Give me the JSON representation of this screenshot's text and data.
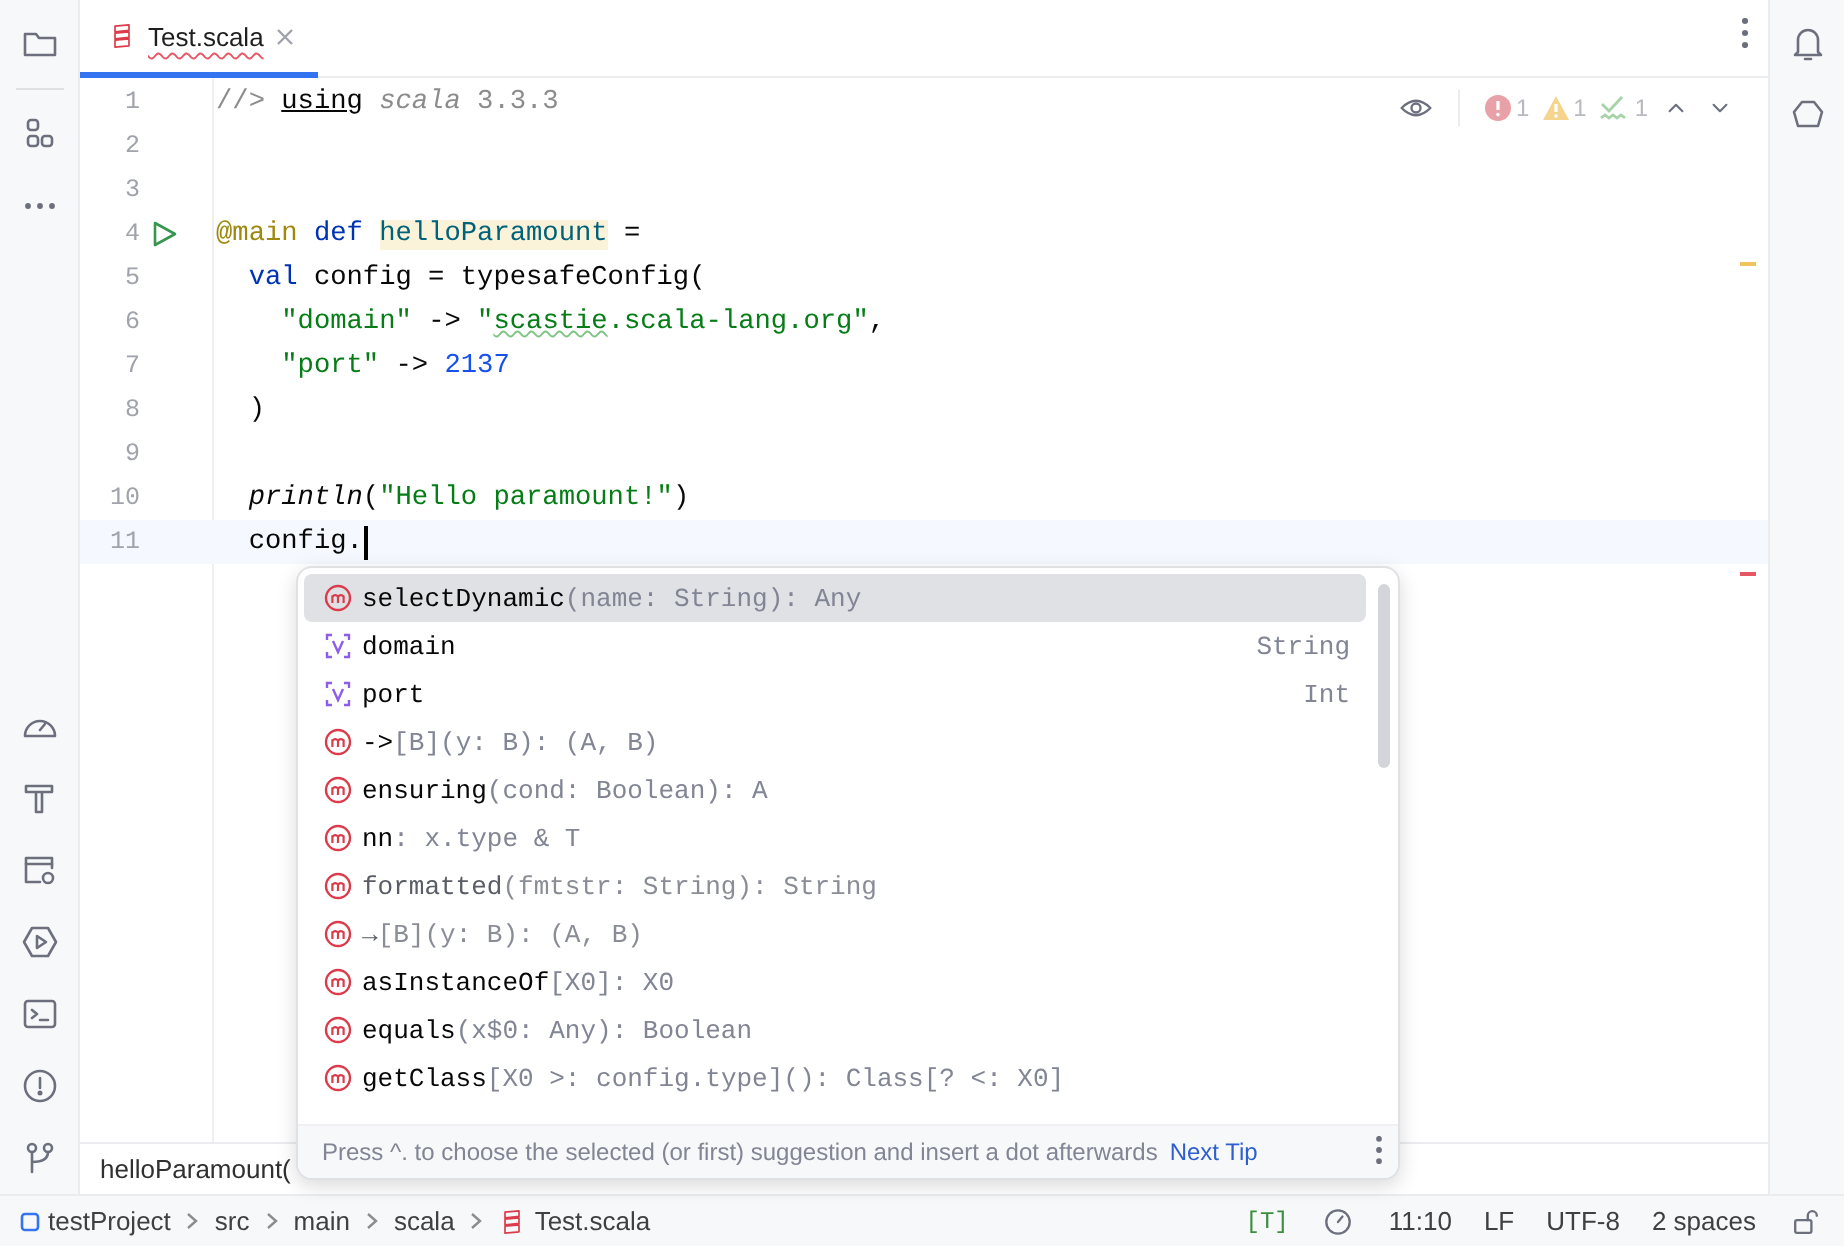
{
  "tab": {
    "label": "Test.scala",
    "selected": true
  },
  "inspections": [
    {
      "kind": "error",
      "count": "1"
    },
    {
      "kind": "warning",
      "count": "1"
    },
    {
      "kind": "typo",
      "count": "1"
    }
  ],
  "lines": [
    {
      "number": "1",
      "run": false,
      "current": false,
      "tokens": [
        {
          "kind": "comment",
          "text": "//> "
        },
        {
          "kind": "directive",
          "text": "using"
        },
        {
          "kind": "comment-italic",
          "text": " scala"
        },
        {
          "kind": "comment",
          "text": " 3.3.3"
        }
      ]
    },
    {
      "number": "2",
      "run": false,
      "current": false
    },
    {
      "number": "3",
      "run": false,
      "current": false
    },
    {
      "number": "4",
      "run": true,
      "current": false,
      "tokens": [
        {
          "kind": "annotation",
          "text": "@main "
        },
        {
          "kind": "keyword",
          "text": "def "
        },
        {
          "kind": "definition",
          "text": "helloParamount"
        },
        {
          "kind": "plain",
          "text": " ="
        }
      ]
    },
    {
      "number": "5",
      "run": false,
      "current": false,
      "tokens": [
        {
          "kind": "keyword",
          "text": "  val"
        },
        {
          "kind": "plain",
          "text": " config = typesafeConfig("
        }
      ]
    },
    {
      "number": "6",
      "run": false,
      "current": false,
      "tokens": [
        {
          "kind": "string",
          "text": "    \"domain\""
        },
        {
          "kind": "plain",
          "text": " -> "
        },
        {
          "kind": "string",
          "text": "\""
        },
        {
          "kind": "string-typo",
          "text": "scastie"
        },
        {
          "kind": "string",
          "text": ".scala-lang.org\""
        },
        {
          "kind": "plain",
          "text": ","
        }
      ]
    },
    {
      "number": "7",
      "run": false,
      "current": false,
      "tokens": [
        {
          "kind": "string",
          "text": "    \"port\""
        },
        {
          "kind": "plain",
          "text": " -> "
        },
        {
          "kind": "number",
          "text": "2137"
        }
      ]
    },
    {
      "number": "8",
      "run": false,
      "current": false,
      "tokens": [
        {
          "kind": "plain",
          "text": "  )"
        }
      ]
    },
    {
      "number": "9",
      "run": false,
      "current": false
    },
    {
      "number": "10",
      "run": false,
      "current": false,
      "tokens": [
        {
          "kind": "italic",
          "text": "  println"
        },
        {
          "kind": "plain",
          "text": "("
        },
        {
          "kind": "string",
          "text": "\"Hello paramount!\""
        },
        {
          "kind": "plain",
          "text": ")"
        }
      ]
    },
    {
      "number": "11",
      "run": false,
      "current": true,
      "tokens": [
        {
          "kind": "plain",
          "text": "  config."
        }
      ]
    }
  ],
  "completion": {
    "items": [
      {
        "kind": "method",
        "name": "selectDynamic",
        "signature": "(name: String): Any",
        "selected": true,
        "deprecated": false
      },
      {
        "kind": "value",
        "name": "domain",
        "type": "String",
        "selected": false,
        "deprecated": false
      },
      {
        "kind": "value",
        "name": "port",
        "type": "Int",
        "selected": false,
        "deprecated": false
      },
      {
        "kind": "method",
        "name": "->",
        "signature": "[B](y: B): (A, B)",
        "selected": false,
        "deprecated": false
      },
      {
        "kind": "method",
        "name": "ensuring",
        "signature": "(cond: Boolean): A",
        "selected": false,
        "deprecated": false
      },
      {
        "kind": "method",
        "name": "nn",
        "signature": ": x.type & T",
        "selected": false,
        "deprecated": false
      },
      {
        "kind": "method",
        "name": "formatted",
        "signature": "(fmtstr: String): String",
        "selected": false,
        "deprecated": true
      },
      {
        "kind": "method",
        "name": "→",
        "signature": "[B](y: B): (A, B)",
        "selected": false,
        "deprecated": true
      },
      {
        "kind": "method",
        "name": "asInstanceOf",
        "signature": "[X0]: X0",
        "selected": false,
        "deprecated": false
      },
      {
        "kind": "method",
        "name": "equals",
        "signature": "(x$0: Any): Boolean",
        "selected": false,
        "deprecated": false
      },
      {
        "kind": "method",
        "name": "getClass",
        "signature": "[X0 >: config.type](): Class[? <: X0]",
        "selected": false,
        "deprecated": false
      }
    ],
    "tip": "Press ^. to choose the selected (or first) suggestion and insert a dot afterwards",
    "tip_link": "Next Tip"
  },
  "breadcrumb": "helloParamount(",
  "status": {
    "path": [
      {
        "kind": "project",
        "label": "testProject"
      },
      {
        "kind": "folder",
        "label": "src"
      },
      {
        "kind": "folder",
        "label": "main"
      },
      {
        "kind": "folder",
        "label": "scala"
      },
      {
        "kind": "file",
        "label": "Test.scala"
      }
    ],
    "items": [
      {
        "kind": "badge",
        "label": "[T]"
      },
      {
        "kind": "clock"
      },
      {
        "kind": "text",
        "label": "11:10"
      },
      {
        "kind": "text",
        "label": "LF"
      },
      {
        "kind": "text",
        "label": "UTF-8"
      },
      {
        "kind": "text",
        "label": "2 spaces"
      },
      {
        "kind": "lock"
      }
    ]
  }
}
